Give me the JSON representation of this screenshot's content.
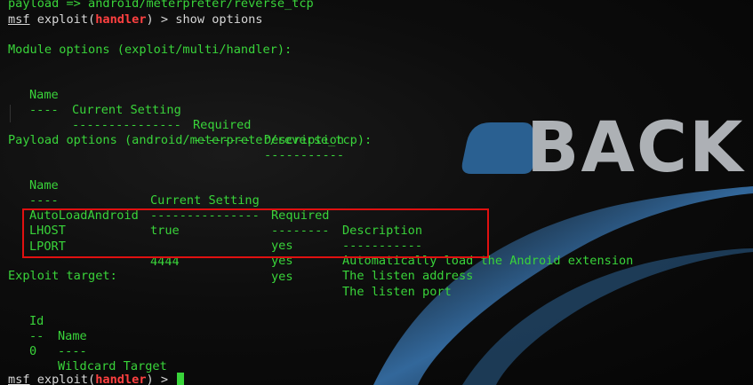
{
  "terminal": {
    "line_payload_set": "payload => android/meterpreter/reverse_tcp",
    "prompt": {
      "msf": "msf",
      "exploit_open": " exploit(",
      "module": "handler",
      "exploit_close": ") > "
    },
    "command": "show options",
    "module_options_heading": "Module options (exploit/multi/handler):",
    "module_table": {
      "headers": [
        "Name",
        "Current Setting",
        "Required",
        "Description"
      ],
      "separators": [
        "----",
        "---------------",
        "--------",
        "-----------"
      ]
    },
    "payload_options_heading": "Payload options (android/meterpreter/reverse_tcp):",
    "payload_table": {
      "headers": [
        "Name",
        "Current Setting",
        "Required",
        "Description"
      ],
      "separators": [
        "----",
        "---------------",
        "--------",
        "-----------"
      ],
      "rows": [
        {
          "name": "AutoLoadAndroid",
          "setting": "true",
          "required": "yes",
          "description": "Automatically load the Android extension"
        },
        {
          "name": "LHOST",
          "setting": "",
          "required": "yes",
          "description": "The listen address"
        },
        {
          "name": "LPORT",
          "setting": "4444",
          "required": "yes",
          "description": "The listen port"
        }
      ]
    },
    "exploit_target_heading": "Exploit target:",
    "target_table": {
      "headers": [
        "Id",
        "Name"
      ],
      "separators": [
        "--",
        "----"
      ],
      "rows": [
        {
          "id": "0",
          "name": "Wildcard Target"
        }
      ]
    }
  },
  "wallpaper": {
    "logo_text": "BACK",
    "logo_color": "#bfc3c8",
    "logo_mark_color": "#2f6fa8"
  },
  "colors": {
    "terminal_text": "#39d43a",
    "prompt_text": "#d7d7d7",
    "prompt_module": "#ff4040",
    "highlight_border": "#e01010"
  }
}
